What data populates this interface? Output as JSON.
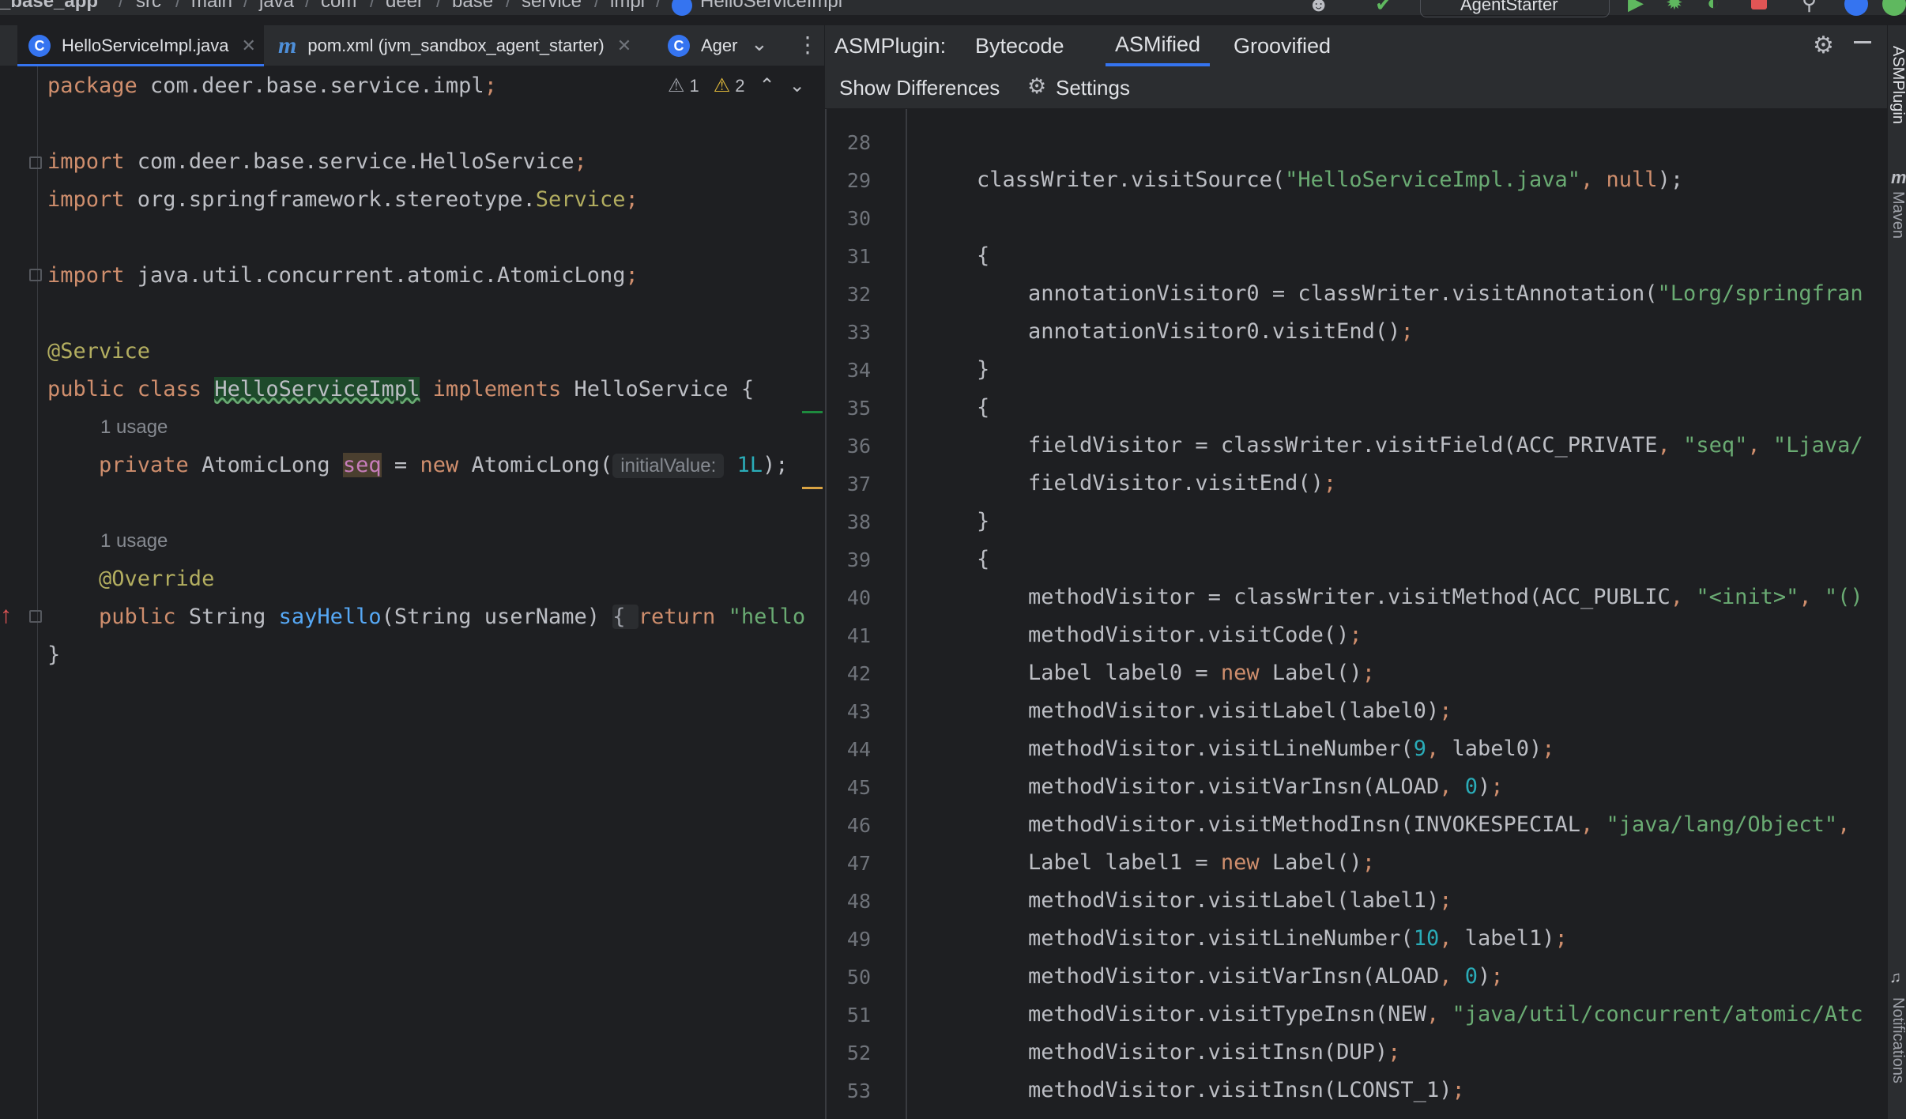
{
  "breadcrumb": {
    "items": [
      "_base_app",
      "src",
      "main",
      "java",
      "com",
      "deer",
      "base",
      "service",
      "impl",
      "HelloServiceImpl"
    ],
    "run_config": "AgentStarter"
  },
  "editor_tabs": [
    {
      "label": "HelloServiceImpl.java",
      "icon": "C"
    },
    {
      "label": "pom.xml (jvm_sandbox_agent_starter)",
      "icon": "m"
    },
    {
      "label": "Ager",
      "icon": "C"
    }
  ],
  "inspections": {
    "weak_warnings": "1",
    "warnings": "2"
  },
  "source_lines": [
    {
      "row": 0,
      "parts": [
        [
          "kw",
          "package "
        ],
        [
          "",
          "com.deer.base.service.impl"
        ],
        [
          "kw",
          ";"
        ]
      ]
    },
    {
      "row": 2,
      "parts": [
        [
          "kw",
          "import "
        ],
        [
          "",
          "com.deer.base.service.HelloService"
        ],
        [
          "kw",
          ";"
        ]
      ]
    },
    {
      "row": 3,
      "parts": [
        [
          "kw",
          "import "
        ],
        [
          "",
          "org.springframework.stereotype."
        ],
        [
          "ann",
          "Service"
        ],
        [
          "kw",
          ";"
        ]
      ]
    },
    {
      "row": 5,
      "parts": [
        [
          "kw",
          "import "
        ],
        [
          "",
          "java.util.concurrent.atomic.AtomicLong"
        ],
        [
          "kw",
          ";"
        ]
      ]
    },
    {
      "row": 7,
      "parts": [
        [
          "ann",
          "@Service"
        ]
      ]
    },
    {
      "row": 8,
      "parts": [
        [
          "kw",
          "public class "
        ],
        [
          "cls",
          "HelloServiceImpl"
        ],
        [
          "kw",
          " implements "
        ],
        [
          "",
          "HelloService {"
        ]
      ]
    },
    {
      "row": 10,
      "parts": [
        [
          "kw",
          "    private "
        ],
        [
          "",
          "AtomicLong "
        ],
        [
          "seq",
          "seq"
        ],
        [
          "",
          " = "
        ],
        [
          "kw",
          "new "
        ],
        [
          "",
          "AtomicLong("
        ],
        [
          "hint",
          "initialValue:"
        ],
        [
          "num",
          " 1L"
        ],
        [
          "",
          "); "
        ]
      ]
    },
    {
      "row": 13,
      "parts": [
        [
          "ann",
          "    @Override"
        ]
      ]
    },
    {
      "row": 14,
      "parts": [
        [
          "kw",
          "    public "
        ],
        [
          "",
          "String "
        ],
        [
          "fn",
          "sayHello"
        ],
        [
          "",
          "(String userName) "
        ],
        [
          "brace",
          "{ "
        ],
        [
          "kw",
          "return "
        ],
        [
          "str",
          "\"hello"
        ]
      ]
    },
    {
      "row": 15,
      "parts": [
        [
          "",
          "}"
        ]
      ]
    }
  ],
  "usages": [
    {
      "row": 9,
      "label": "1 usage"
    },
    {
      "row": 12,
      "label": "1 usage"
    }
  ],
  "asm_panel": {
    "title": "ASMPlugin:",
    "tabs": [
      "Bytecode",
      "ASMified",
      "Groovified"
    ],
    "active_tab": "ASMified",
    "show_differences": "Show Differences",
    "settings": "Settings"
  },
  "asm_lines": [
    {
      "n": "28",
      "parts": []
    },
    {
      "n": "29",
      "parts": [
        [
          "",
          "classWriter.visitSource("
        ],
        [
          "str",
          "\"HelloServiceImpl.java\""
        ],
        [
          "kw",
          ", "
        ],
        [
          "kw",
          "null"
        ],
        [
          "",
          ");"
        ]
      ]
    },
    {
      "n": "30",
      "parts": []
    },
    {
      "n": "31",
      "parts": [
        [
          "",
          "{"
        ]
      ]
    },
    {
      "n": "32",
      "parts": [
        [
          "",
          "    annotationVisitor0 = classWriter.visitAnnotation("
        ],
        [
          "str",
          "\"Lorg/springfran"
        ]
      ]
    },
    {
      "n": "33",
      "parts": [
        [
          "",
          "    annotationVisitor0.visitEnd()"
        ],
        [
          "kw",
          ";"
        ]
      ]
    },
    {
      "n": "34",
      "parts": [
        [
          "",
          "}"
        ]
      ]
    },
    {
      "n": "35",
      "parts": [
        [
          "",
          "{"
        ]
      ]
    },
    {
      "n": "36",
      "parts": [
        [
          "",
          "    fieldVisitor = classWriter.visitField(ACC_PRIVATE"
        ],
        [
          "kw",
          ", "
        ],
        [
          "str",
          "\"seq\""
        ],
        [
          "kw",
          ", "
        ],
        [
          "str",
          "\"Ljava/"
        ]
      ]
    },
    {
      "n": "37",
      "parts": [
        [
          "",
          "    fieldVisitor.visitEnd()"
        ],
        [
          "kw",
          ";"
        ]
      ]
    },
    {
      "n": "38",
      "parts": [
        [
          "",
          "}"
        ]
      ]
    },
    {
      "n": "39",
      "parts": [
        [
          "",
          "{"
        ]
      ]
    },
    {
      "n": "40",
      "parts": [
        [
          "",
          "    methodVisitor = classWriter.visitMethod(ACC_PUBLIC"
        ],
        [
          "kw",
          ", "
        ],
        [
          "str",
          "\"<init>\""
        ],
        [
          "kw",
          ", "
        ],
        [
          "str",
          "\"()"
        ]
      ]
    },
    {
      "n": "41",
      "parts": [
        [
          "",
          "    methodVisitor.visitCode()"
        ],
        [
          "kw",
          ";"
        ]
      ]
    },
    {
      "n": "42",
      "parts": [
        [
          "",
          "    Label label0 = "
        ],
        [
          "kw",
          "new "
        ],
        [
          "",
          "Label()"
        ],
        [
          "kw",
          ";"
        ]
      ]
    },
    {
      "n": "43",
      "parts": [
        [
          "",
          "    methodVisitor.visitLabel(label0)"
        ],
        [
          "kw",
          ";"
        ]
      ]
    },
    {
      "n": "44",
      "parts": [
        [
          "",
          "    methodVisitor.visitLineNumber("
        ],
        [
          "num",
          "9"
        ],
        [
          "kw",
          ", "
        ],
        [
          "",
          "label0)"
        ],
        [
          "kw",
          ";"
        ]
      ]
    },
    {
      "n": "45",
      "parts": [
        [
          "",
          "    methodVisitor.visitVarInsn(ALOAD"
        ],
        [
          "kw",
          ", "
        ],
        [
          "num",
          "0"
        ],
        [
          "",
          ")"
        ],
        [
          "kw",
          ";"
        ]
      ]
    },
    {
      "n": "46",
      "parts": [
        [
          "",
          "    methodVisitor.visitMethodInsn(INVOKESPECIAL"
        ],
        [
          "kw",
          ", "
        ],
        [
          "str",
          "\"java/lang/Object\""
        ],
        [
          "kw",
          ","
        ]
      ]
    },
    {
      "n": "47",
      "parts": [
        [
          "",
          "    Label label1 = "
        ],
        [
          "kw",
          "new "
        ],
        [
          "",
          "Label()"
        ],
        [
          "kw",
          ";"
        ]
      ]
    },
    {
      "n": "48",
      "parts": [
        [
          "",
          "    methodVisitor.visitLabel(label1)"
        ],
        [
          "kw",
          ";"
        ]
      ]
    },
    {
      "n": "49",
      "parts": [
        [
          "",
          "    methodVisitor.visitLineNumber("
        ],
        [
          "num",
          "10"
        ],
        [
          "kw",
          ", "
        ],
        [
          "",
          "label1)"
        ],
        [
          "kw",
          ";"
        ]
      ]
    },
    {
      "n": "50",
      "parts": [
        [
          "",
          "    methodVisitor.visitVarInsn(ALOAD"
        ],
        [
          "kw",
          ", "
        ],
        [
          "num",
          "0"
        ],
        [
          "",
          ")"
        ],
        [
          "kw",
          ";"
        ]
      ]
    },
    {
      "n": "51",
      "parts": [
        [
          "",
          "    methodVisitor.visitTypeInsn(NEW"
        ],
        [
          "kw",
          ", "
        ],
        [
          "str",
          "\"java/util/concurrent/atomic/Atc"
        ]
      ]
    },
    {
      "n": "52",
      "parts": [
        [
          "",
          "    methodVisitor.visitInsn(DUP)"
        ],
        [
          "kw",
          ";"
        ]
      ]
    },
    {
      "n": "53",
      "parts": [
        [
          "",
          "    methodVisitor.visitInsn(LCONST_1)"
        ],
        [
          "kw",
          ";"
        ]
      ]
    }
  ],
  "tool_windows": {
    "right": [
      "ASMPlugin",
      "Maven",
      "Notifications"
    ]
  },
  "colors": {
    "accent": "#3574f0",
    "keyword": "#cf8e6d",
    "string": "#6aab73",
    "number": "#2aacb8",
    "annotation": "#b3ae60",
    "background": "#1e1f22"
  }
}
